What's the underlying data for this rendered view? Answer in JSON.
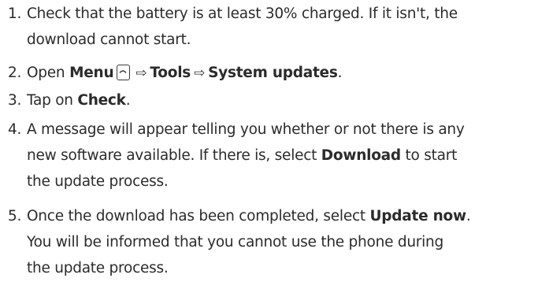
{
  "steps": [
    {
      "number": "1.",
      "line1": "Check that the battery is at least 30% charged. If it isn't, the",
      "line2": "download cannot start."
    },
    {
      "number": "2.",
      "open": "Open",
      "menu": "Menu",
      "arrow1": "⇨",
      "tools": "Tools",
      "arrow2": "⇨",
      "system_updates": "System updates",
      "end": "."
    },
    {
      "number": "3.",
      "tap_on": "Tap on",
      "check": "Check",
      "end": "."
    },
    {
      "number": "4.",
      "line1": "A message will appear telling you whether or not there is any",
      "line2": "new software available. If there is, select",
      "download": "Download",
      "line2_end": "to start",
      "line3": "the update process."
    },
    {
      "number": "5.",
      "line1": "Once the download has been completed, select",
      "update_now": "Update now",
      "line1_end": ".",
      "line2": "You will be informed that you cannot use the phone during",
      "line3": "the update process."
    }
  ],
  "icons": {
    "menu_key": "menu-key-icon",
    "arrow": "right-arrow-icon"
  },
  "colors": {
    "text": "#2b2b2b",
    "background": "#ffffff"
  }
}
